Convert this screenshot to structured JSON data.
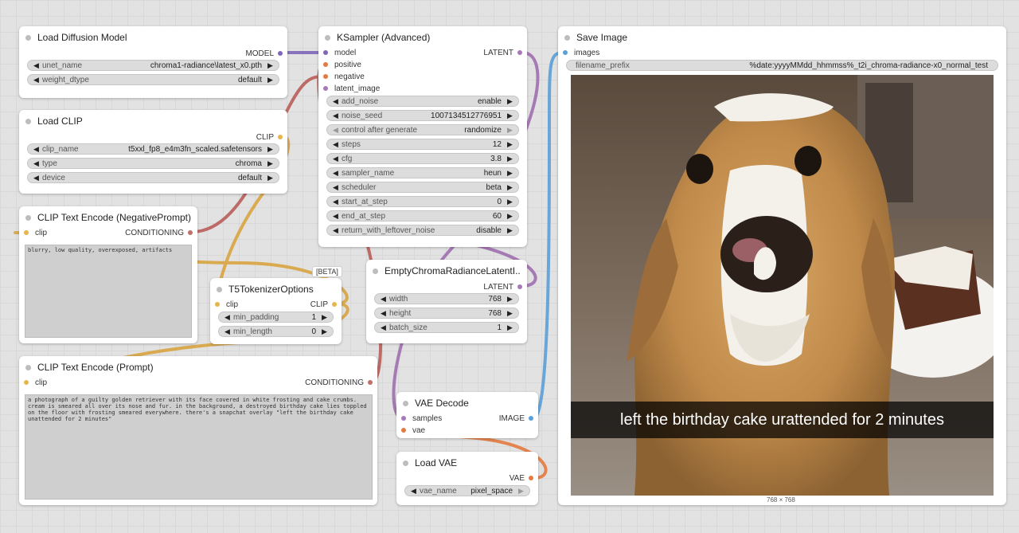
{
  "colors": {
    "canvas": "#e2e2e2",
    "model": "#8066b8",
    "clip": "#e8b44c",
    "conditioning": "#c26f6b",
    "latent": "#a878b8",
    "image": "#5b9fd8",
    "vae": "#e57a40"
  },
  "nodes": {
    "load_diffusion_model": {
      "title": "Load Diffusion Model",
      "output": "MODEL",
      "widgets": [
        {
          "label": "unet_name",
          "value": "chroma1-radiance\\latest_x0.pth"
        },
        {
          "label": "weight_dtype",
          "value": "default"
        }
      ]
    },
    "load_clip": {
      "title": "Load CLIP",
      "output": "CLIP",
      "widgets": [
        {
          "label": "clip_name",
          "value": "t5xxl_fp8_e4m3fn_scaled.safetensors"
        },
        {
          "label": "type",
          "value": "chroma"
        },
        {
          "label": "device",
          "value": "default"
        }
      ]
    },
    "clip_text_encode_negative": {
      "title": "CLIP Text Encode (NegativePrompt)",
      "input": "clip",
      "output": "CONDITIONING",
      "text": "blurry, low quality, overexposed, artifacts"
    },
    "t5_tokenizer_options": {
      "title": "T5TokenizerOptions",
      "badge": "[BETA]",
      "input": "clip",
      "output": "CLIP",
      "widgets": [
        {
          "label": "min_padding",
          "value": "1"
        },
        {
          "label": "min_length",
          "value": "0"
        }
      ]
    },
    "clip_text_encode_prompt": {
      "title": "CLIP Text Encode (Prompt)",
      "input": "clip",
      "output": "CONDITIONING",
      "text": "a photograph of a guilty golden retriever with its face covered in white frosting and cake crumbs. cream is smeared all over its nose and fur. in the background, a destroyed birthday cake lies toppled on the floor with frosting smeared everywhere. there's a snapchat overlay \"left the birthday cake unattended for 2 minutes\""
    },
    "ksampler": {
      "title": "KSampler (Advanced)",
      "inputs": [
        "model",
        "positive",
        "negative",
        "latent_image"
      ],
      "output": "LATENT",
      "widgets": [
        {
          "label": "add_noise",
          "value": "enable"
        },
        {
          "label": "noise_seed",
          "value": "1007134512776951"
        },
        {
          "label": "control after generate",
          "value": "randomize"
        },
        {
          "label": "steps",
          "value": "12"
        },
        {
          "label": "cfg",
          "value": "3.8"
        },
        {
          "label": "sampler_name",
          "value": "heun"
        },
        {
          "label": "scheduler",
          "value": "beta"
        },
        {
          "label": "start_at_step",
          "value": "0"
        },
        {
          "label": "end_at_step",
          "value": "60"
        },
        {
          "label": "return_with_leftover_noise",
          "value": "disable"
        }
      ]
    },
    "empty_latent": {
      "title": "EmptyChromaRadianceLatentI...",
      "output": "LATENT",
      "widgets": [
        {
          "label": "width",
          "value": "768"
        },
        {
          "label": "height",
          "value": "768"
        },
        {
          "label": "batch_size",
          "value": "1"
        }
      ]
    },
    "vae_decode": {
      "title": "VAE Decode",
      "inputs": [
        "samples",
        "vae"
      ],
      "output": "IMAGE"
    },
    "load_vae": {
      "title": "Load VAE",
      "output": "VAE",
      "widgets": [
        {
          "label": "vae_name",
          "value": "pixel_space"
        }
      ]
    },
    "save_image": {
      "title": "Save Image",
      "input": "images",
      "widgets": [
        {
          "label": "filename_prefix",
          "value": "%date:yyyyMMdd_hhmmss%_t2i_chroma-radiance-x0_normal_test"
        }
      ],
      "caption": "left the birthday cake urattended for 2 minutes",
      "dimensions": "768 × 768"
    }
  }
}
